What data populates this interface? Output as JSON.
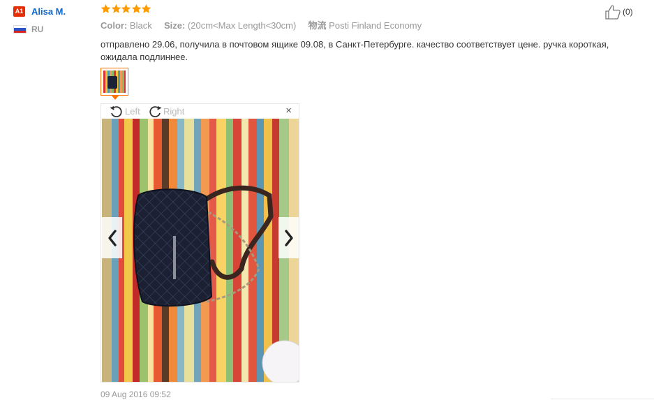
{
  "user": {
    "badge": "A1",
    "name": "Alisa M.",
    "country_code": "RU"
  },
  "review": {
    "stars": 5,
    "color_label": "Color:",
    "color_value": "Black",
    "size_label": "Size:",
    "size_value": "(20cm<Max Length<30cm)",
    "shipping_label": "物流",
    "shipping_value": "Posti Finland Economy",
    "text": "отправлено 29.06, получила в почтовом ящике 09.08, в Санкт-Петербурге. качество соответствует цене. ручка короткая, ожидала подлиннее.",
    "date": "09 Aug 2016 09:52"
  },
  "viewer": {
    "rotate_left_label": "Left",
    "rotate_right_label": "Right",
    "close_label": "×"
  },
  "helpful": {
    "count": "(0)"
  },
  "colors": {
    "star": "#ff9a00",
    "name_link": "#1166cc",
    "badge": "#e62e04",
    "thumb_border": "#ff7300",
    "muted_text": "#999999",
    "body_text": "#333333"
  },
  "icons": {
    "thumbs_up": "thumbs-up-icon",
    "rotate_left": "rotate-left-icon",
    "rotate_right": "rotate-right-icon",
    "close": "close-icon",
    "prev": "chevron-left-icon",
    "next": "chevron-right-icon",
    "flag": "russia-flag-icon",
    "star": "star-icon"
  }
}
